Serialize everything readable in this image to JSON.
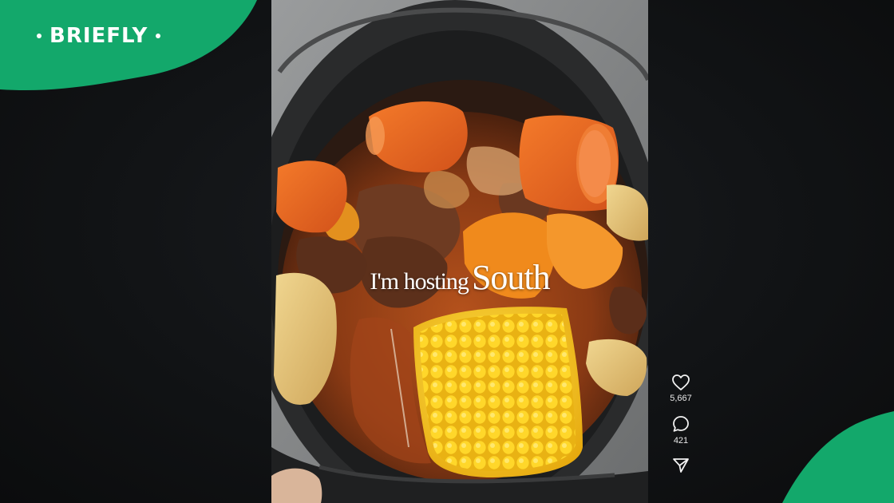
{
  "brand": {
    "name": "BRIEFLY",
    "accent_color": "#13a86b"
  },
  "video": {
    "caption_prefix": "I'm hosting",
    "caption_emphasis": "South"
  },
  "actions": {
    "like": {
      "icon": "heart-icon",
      "count": "5,667"
    },
    "comment": {
      "icon": "comment-icon",
      "count": "421"
    },
    "share": {
      "icon": "send-icon"
    }
  }
}
